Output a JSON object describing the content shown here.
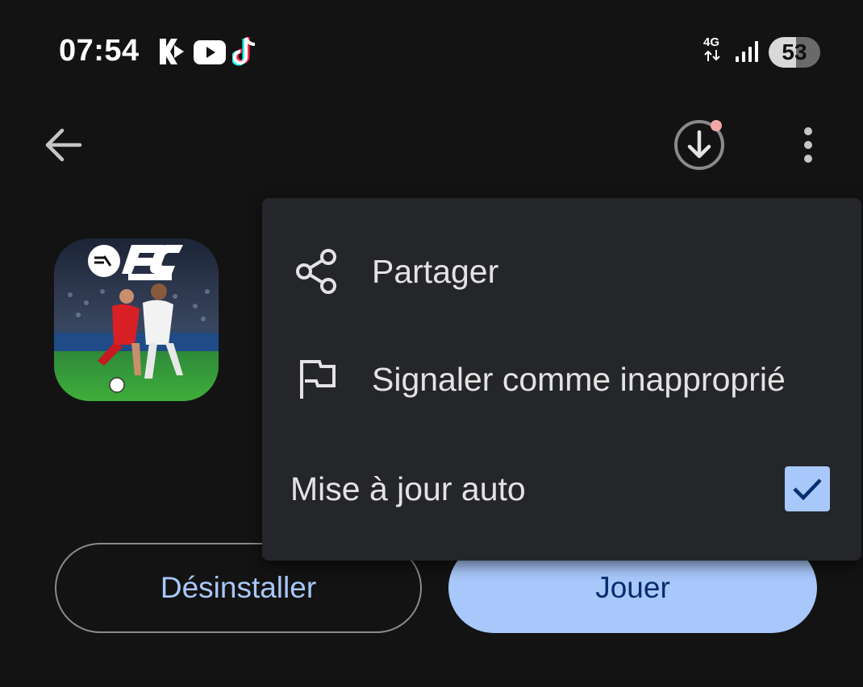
{
  "status_bar": {
    "time": "07:54",
    "network": "4G",
    "battery": "53",
    "icons": [
      "kick-icon",
      "youtube-icon",
      "tiktok-icon",
      "network-4g-icon",
      "signal-icon",
      "battery-icon"
    ]
  },
  "app_bar": {
    "icons": [
      "back-arrow-icon",
      "download-icon",
      "more-vert-icon"
    ],
    "download_badge_color": "#f4a7a7"
  },
  "app": {
    "icon_name": "fc-mobile-app-icon"
  },
  "actions": {
    "uninstall_label": "Désinstaller",
    "play_label": "Jouer"
  },
  "menu": {
    "share_label": "Partager",
    "report_label": "Signaler comme inapproprié",
    "auto_update_label": "Mise à jour auto",
    "auto_update_checked": true
  },
  "colors": {
    "background": "#131313",
    "menu_surface": "#252629",
    "accent": "#a8c7fa",
    "on_accent": "#062e6f"
  }
}
